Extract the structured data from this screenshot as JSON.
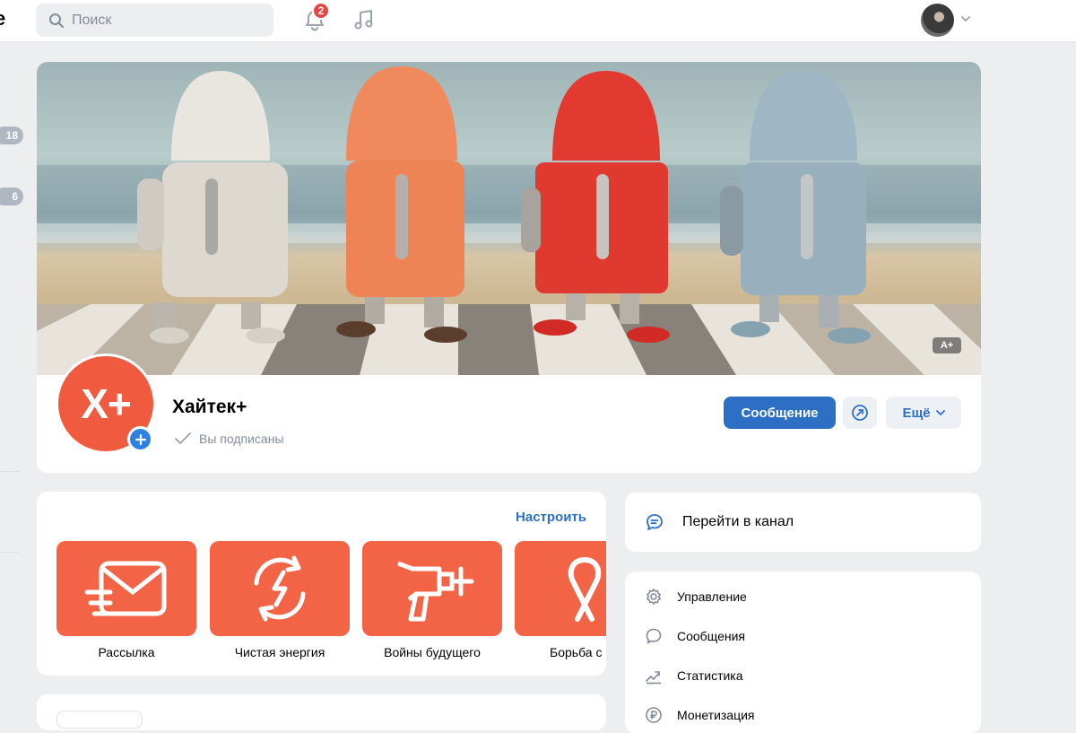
{
  "header": {
    "logo_fragment": "e",
    "search_placeholder": "Поиск",
    "notifications_count": "2"
  },
  "sidebar": {
    "counters": [
      "18",
      "6"
    ]
  },
  "profile": {
    "cover_badge": "A+",
    "avatar_text": "X+",
    "name": "Хайтек+",
    "subscription_status": "Вы подписаны",
    "message_button": "Сообщение",
    "more_button": "Ещё"
  },
  "topics": {
    "configure_label": "Настроить",
    "items": [
      {
        "label": "Рассылка",
        "icon": "envelope-icon"
      },
      {
        "label": "Чистая энергия",
        "icon": "energy-cycle-icon"
      },
      {
        "label": "Войны будущего",
        "icon": "ray-gun-icon"
      },
      {
        "label": "Борьба с ра",
        "icon": "ribbon-icon"
      }
    ]
  },
  "right": {
    "channel_label": "Перейти в канал",
    "menu": [
      {
        "label": "Управление",
        "icon": "gear-icon"
      },
      {
        "label": "Сообщения",
        "icon": "chat-bubble-icon"
      },
      {
        "label": "Статистика",
        "icon": "chart-trend-icon"
      },
      {
        "label": "Монетизация",
        "icon": "ruble-coin-icon"
      }
    ]
  },
  "colors": {
    "accent": "#2d6fc4",
    "topic_tile": "#f26445",
    "badge": "#e64646",
    "page_bg": "#edeef0"
  }
}
